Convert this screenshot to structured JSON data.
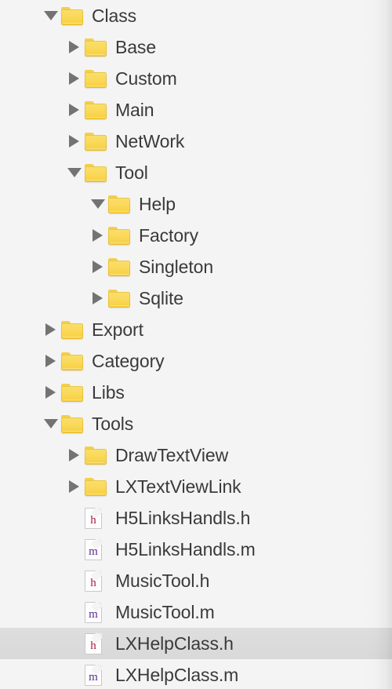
{
  "panel": {
    "name": "project-navigator",
    "background_color": "#f4f4f4",
    "selection_color": "#dcdcdc",
    "folder_color": "#fad95c",
    "text_color": "#3a3a3c",
    "header_glyph_color": "#a81f42",
    "module_glyph_color": "#5b2d8e"
  },
  "tree": {
    "rows": [
      {
        "label": "Class",
        "depth": 1,
        "kind": "folder",
        "state": "expanded",
        "selected": false
      },
      {
        "label": "Base",
        "depth": 2,
        "kind": "folder",
        "state": "collapsed",
        "selected": false
      },
      {
        "label": "Custom",
        "depth": 2,
        "kind": "folder",
        "state": "collapsed",
        "selected": false
      },
      {
        "label": "Main",
        "depth": 2,
        "kind": "folder",
        "state": "collapsed",
        "selected": false
      },
      {
        "label": "NetWork",
        "depth": 2,
        "kind": "folder",
        "state": "collapsed",
        "selected": false
      },
      {
        "label": "Tool",
        "depth": 2,
        "kind": "folder",
        "state": "expanded",
        "selected": false
      },
      {
        "label": "Help",
        "depth": 3,
        "kind": "folder",
        "state": "expanded",
        "selected": false
      },
      {
        "label": "Factory",
        "depth": 3,
        "kind": "folder",
        "state": "collapsed",
        "selected": false
      },
      {
        "label": "Singleton",
        "depth": 3,
        "kind": "folder",
        "state": "collapsed",
        "selected": false
      },
      {
        "label": "Sqlite",
        "depth": 3,
        "kind": "folder",
        "state": "collapsed",
        "selected": false
      },
      {
        "label": "Export",
        "depth": 1,
        "kind": "folder",
        "state": "collapsed",
        "selected": false
      },
      {
        "label": "Category",
        "depth": 1,
        "kind": "folder",
        "state": "collapsed",
        "selected": false
      },
      {
        "label": "Libs",
        "depth": 1,
        "kind": "folder",
        "state": "collapsed",
        "selected": false
      },
      {
        "label": "Tools",
        "depth": 1,
        "kind": "folder",
        "state": "expanded",
        "selected": false
      },
      {
        "label": "DrawTextView",
        "depth": 2,
        "kind": "folder",
        "state": "collapsed",
        "selected": false
      },
      {
        "label": "LXTextViewLink",
        "depth": 2,
        "kind": "folder",
        "state": "collapsed",
        "selected": false
      },
      {
        "label": "H5LinksHandls.h",
        "depth": 2,
        "kind": "file-h",
        "state": "leaf",
        "selected": false
      },
      {
        "label": "H5LinksHandls.m",
        "depth": 2,
        "kind": "file-m",
        "state": "leaf",
        "selected": false
      },
      {
        "label": "MusicTool.h",
        "depth": 2,
        "kind": "file-h",
        "state": "leaf",
        "selected": false
      },
      {
        "label": "MusicTool.m",
        "depth": 2,
        "kind": "file-m",
        "state": "leaf",
        "selected": false
      },
      {
        "label": "LXHelpClass.h",
        "depth": 2,
        "kind": "file-h",
        "state": "leaf",
        "selected": true
      },
      {
        "label": "LXHelpClass.m",
        "depth": 2,
        "kind": "file-m",
        "state": "leaf",
        "selected": false
      }
    ],
    "icon_names": {
      "folder": "folder-icon",
      "file-h": "header-file-icon",
      "file-m": "objc-source-file-icon",
      "expanded": "disclosure-triangle-down-icon",
      "collapsed": "disclosure-triangle-right-icon"
    }
  }
}
